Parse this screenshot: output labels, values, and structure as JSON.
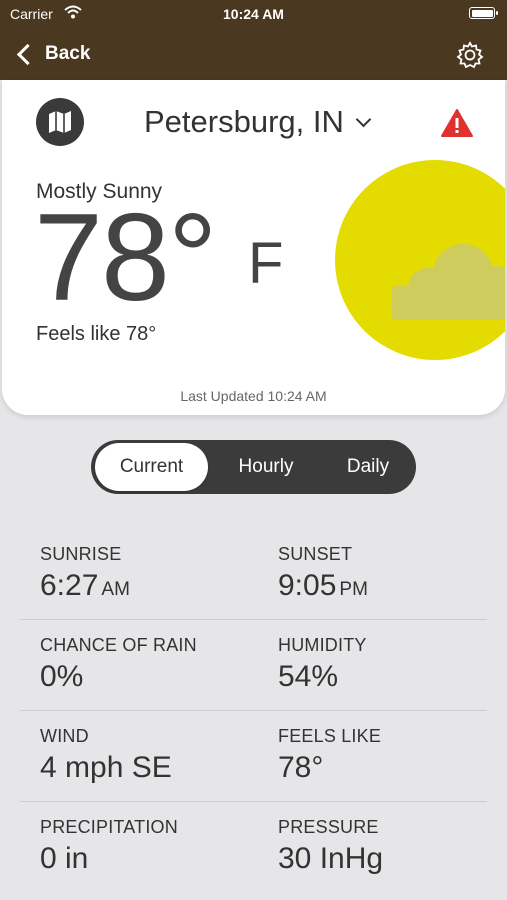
{
  "status_bar": {
    "carrier": "Carrier",
    "time": "10:24 AM"
  },
  "nav": {
    "back_label": "Back",
    "icons": {
      "back": "chevron-left-icon",
      "settings": "gear-icon"
    }
  },
  "current": {
    "location": "Petersburg, IN",
    "condition": "Mostly Sunny",
    "temperature": "78°",
    "unit": "F",
    "feels_like": "Feels like 78°",
    "last_updated": "Last Updated 10:24 AM",
    "icons": {
      "map": "map-icon",
      "alert": "warning-icon",
      "weather": "sun-cloud-icon"
    }
  },
  "tabs": [
    {
      "label": "Current",
      "active": true
    },
    {
      "label": "Hourly",
      "active": false
    },
    {
      "label": "Daily",
      "active": false
    }
  ],
  "details": [
    {
      "left": {
        "label": "SUNRISE",
        "value": "6:27",
        "suffix": "AM"
      },
      "right": {
        "label": "SUNSET",
        "value": "9:05",
        "suffix": "PM"
      }
    },
    {
      "left": {
        "label": "CHANCE OF RAIN",
        "value": "0%"
      },
      "right": {
        "label": "HUMIDITY",
        "value": "54%"
      }
    },
    {
      "left": {
        "label": "WIND",
        "value": "4 mph SE"
      },
      "right": {
        "label": "FEELS LIKE",
        "value": "78°"
      }
    },
    {
      "left": {
        "label": "PRECIPITATION",
        "value": "0 in"
      },
      "right": {
        "label": "PRESSURE",
        "value": "30 InHg"
      }
    }
  ],
  "colors": {
    "header": "#4a3820",
    "sun": "#e4dc00",
    "alert": "#e03030",
    "background": "#e6e6e8",
    "segment": "#3b3b3b"
  }
}
